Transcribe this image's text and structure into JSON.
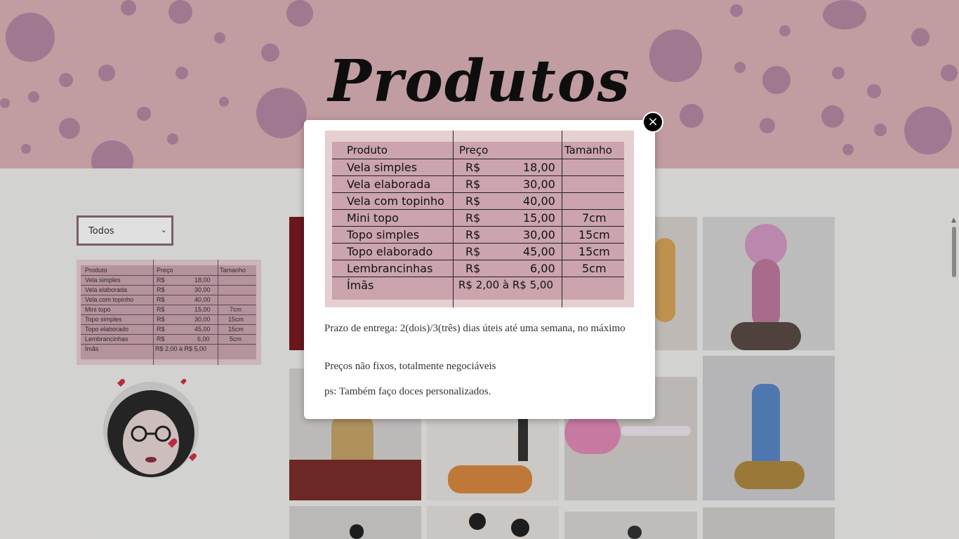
{
  "page": {
    "title": "Produtos"
  },
  "filter": {
    "selected": "Todos"
  },
  "price_table": {
    "headers": [
      "Produto",
      "Preço",
      "Tamanho"
    ],
    "rows": [
      {
        "product": "Vela simples",
        "currency": "R$",
        "price": "18,00",
        "size": ""
      },
      {
        "product": "Vela elaborada",
        "currency": "R$",
        "price": "30,00",
        "size": ""
      },
      {
        "product": "Vela com topinho",
        "currency": "R$",
        "price": "40,00",
        "size": ""
      },
      {
        "product": "Mini topo",
        "currency": "R$",
        "price": "15,00",
        "size": "7cm"
      },
      {
        "product": "Topo simples",
        "currency": "R$",
        "price": "30,00",
        "size": "15cm"
      },
      {
        "product": "Topo elaborado",
        "currency": "R$",
        "price": "45,00",
        "size": "15cm"
      },
      {
        "product": "Lembrancinhas",
        "currency": "R$",
        "price": "6,00",
        "size": "5cm"
      },
      {
        "product": "Ímãs",
        "currency": "",
        "price": "R$ 2,00 à R$ 5,00",
        "size": ""
      }
    ]
  },
  "modal": {
    "close_label": "×",
    "delivery": "Prazo de entrega: 2(dois)/3(três) dias úteis até uma semana, no máximo",
    "prices_note": "Preços não fixos, totalmente negociáveis",
    "ps": "ps: Também faço doces personalizados."
  },
  "colors": {
    "hero": "#dcb2b7",
    "dots": "#b78aa5",
    "table_bg": "#cba4ae"
  }
}
